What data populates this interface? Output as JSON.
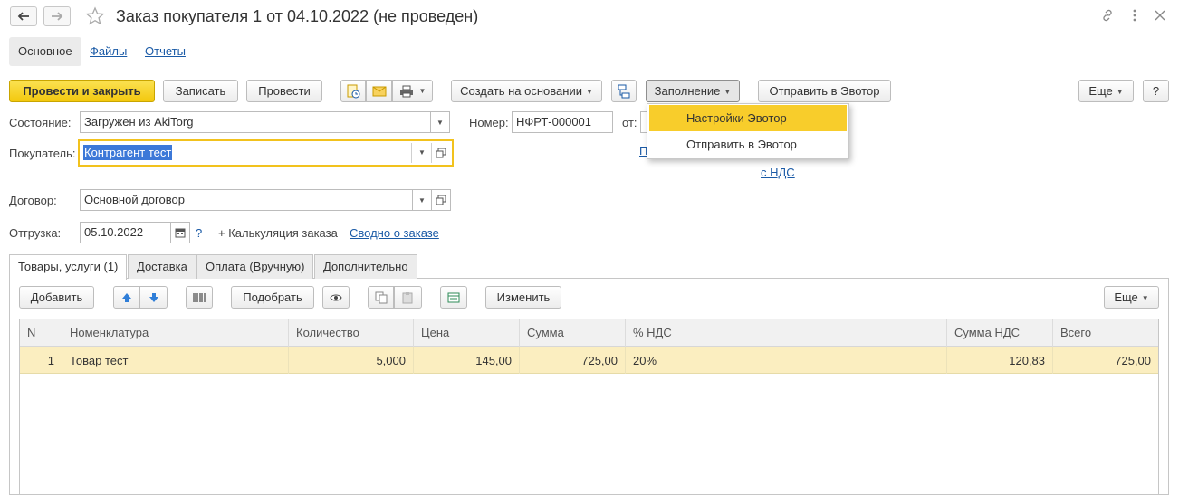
{
  "window": {
    "title": "Заказ покупателя 1 от 04.10.2022 (не проведен)"
  },
  "sections": {
    "main": "Основное",
    "files": "Файлы",
    "reports": "Отчеты"
  },
  "toolbar": {
    "post_close": "Провести и закрыть",
    "save": "Записать",
    "post": "Провести",
    "create_based": "Создать на основании",
    "fill": "Заполнение",
    "send_evotor": "Отправить в Эвотор",
    "more": "Еще",
    "help": "?"
  },
  "fill_menu": {
    "items": [
      "Настройки Эвотор",
      "Отправить в Эвотор"
    ]
  },
  "form": {
    "state_label": "Состояние:",
    "state_value": "Загружен из AkiTorg",
    "number_label": "Номер:",
    "number_value": "НФРТ-000001",
    "from_label": "от:",
    "buyer_label": "Покупатель:",
    "buyer_value": "Контрагент тест",
    "hidden_link_char": "П",
    "vat_link": "с НДС",
    "contract_label": "Договор:",
    "contract_value": "Основной договор",
    "shipment_label": "Отгрузка:",
    "shipment_date": "05.10.2022",
    "question": "?",
    "calc": "+ Калькуляция заказа",
    "summary_link": "Сводно о заказе"
  },
  "tabs": [
    "Товары, услуги (1)",
    "Доставка",
    "Оплата (Вручную)",
    "Дополнительно"
  ],
  "table_toolbar": {
    "add": "Добавить",
    "select": "Подобрать",
    "change": "Изменить",
    "more": "Еще"
  },
  "table": {
    "columns": [
      "N",
      "Номенклатура",
      "Количество",
      "Цена",
      "Сумма",
      "% НДС",
      "Сумма НДС",
      "Всего"
    ],
    "rows": [
      [
        "1",
        "Товар тест",
        "5,000",
        "145,00",
        "725,00",
        "20%",
        "120,83",
        "725,00"
      ]
    ]
  },
  "colors": {
    "primary_button": "#f3c80d",
    "focus_border": "#f2c21d",
    "link": "#1a5aa6",
    "row_selected": "#fbeec0"
  }
}
